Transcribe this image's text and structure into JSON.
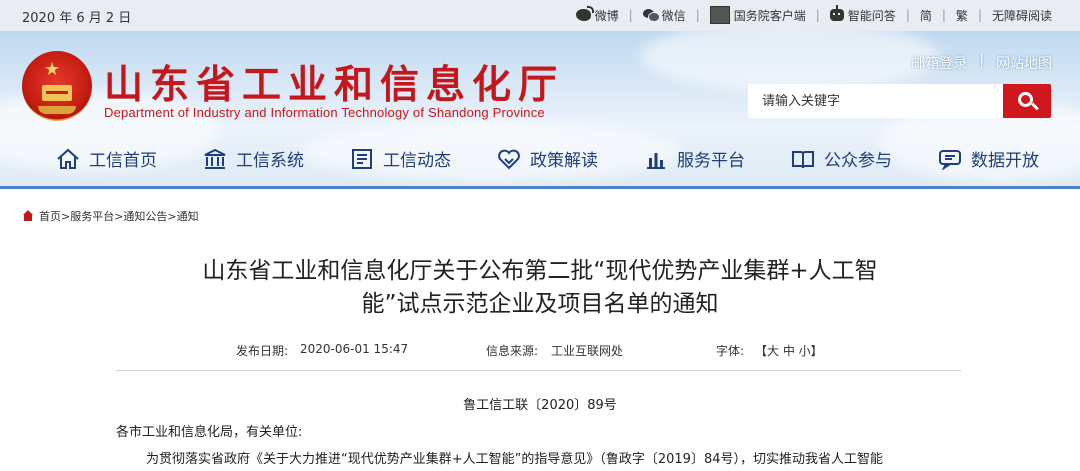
{
  "topbar": {
    "date": "2020 年 6 月 2 日",
    "links": [
      {
        "label": "微博",
        "icon": "weibo-icon"
      },
      {
        "label": "微信",
        "icon": "wechat-icon"
      },
      {
        "label": "国务院客户端",
        "icon": "gov-app-icon"
      },
      {
        "label": "智能问答",
        "icon": "robot-icon"
      },
      {
        "label": "简"
      },
      {
        "label": "繁"
      },
      {
        "label": "无障碍阅读"
      }
    ]
  },
  "header": {
    "title": "山东省工业和信息化厅",
    "subtitle_en": "Department of Industry and Information Technology of Shandong Province",
    "links": [
      "邮箱登录",
      "网站地图"
    ],
    "search": {
      "placeholder": "请输入关键字"
    }
  },
  "nav": [
    {
      "label": "工信首页",
      "icon": "home-icon"
    },
    {
      "label": "工信系统",
      "icon": "building-icon"
    },
    {
      "label": "工信动态",
      "icon": "news-icon"
    },
    {
      "label": "政策解读",
      "icon": "policy-icon"
    },
    {
      "label": "服务平台",
      "icon": "chart-icon"
    },
    {
      "label": "公众参与",
      "icon": "book-icon"
    },
    {
      "label": "数据开放",
      "icon": "chat-icon"
    }
  ],
  "breadcrumb": "首页>服务平台>通知公告>通知",
  "article": {
    "title_line1": "山东省工业和信息化厅关于公布第二批“现代优势产业集群+人工智",
    "title_line2": "能”试点示范企业及项目名单的通知",
    "publish_label": "发布日期:",
    "publish_date": "2020-06-01 15:47",
    "source_label": "信息来源:",
    "source": "工业互联网处",
    "font_label": "字体:",
    "font_options": "【大 中 小】",
    "doc_number": "鲁工信工联〔2020〕89号",
    "salutation": "各市工业和信息化局，有关单位:",
    "body_first_line": "为贯彻落实省政府《关于大力推进“现代优势产业集群+人工智能”的指导意见》（鲁政字〔2019〕84号），切实推动我省人工智能"
  },
  "colors": {
    "brand_red": "#c4171b",
    "nav_blue": "#1e3f7a",
    "search_button": "#d0171c"
  }
}
